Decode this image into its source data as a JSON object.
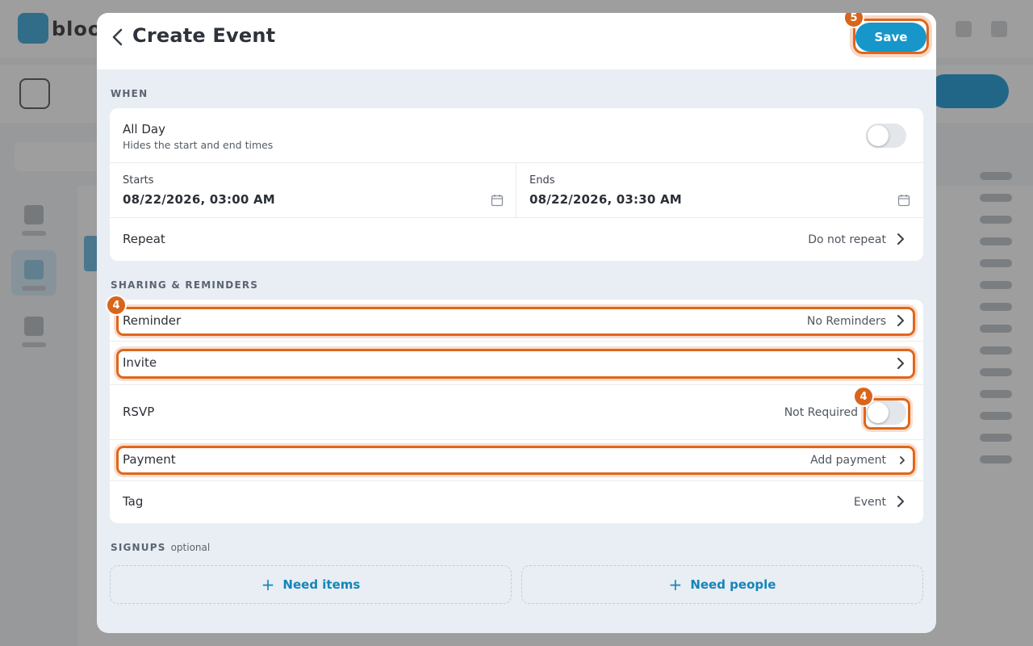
{
  "background": {
    "logo_text": "bloo"
  },
  "modal": {
    "title": "Create Event",
    "save_label": "Save",
    "save_badge": "5"
  },
  "when": {
    "section_label": "WHEN",
    "all_day": {
      "label": "All Day",
      "sub": "Hides the start and end times",
      "on": false
    },
    "starts": {
      "label": "Starts",
      "value": "08/22/2026, 03:00 AM"
    },
    "ends": {
      "label": "Ends",
      "value": "08/22/2026, 03:30 AM"
    },
    "repeat": {
      "label": "Repeat",
      "value": "Do not repeat"
    }
  },
  "sharing": {
    "section_label": "SHARING & REMINDERS",
    "reminder": {
      "label": "Reminder",
      "value": "No Reminders",
      "badge": "4"
    },
    "invite": {
      "label": "Invite"
    },
    "rsvp": {
      "label": "RSVP",
      "value": "Not Required",
      "on": false,
      "badge": "4"
    },
    "payment": {
      "label": "Payment",
      "value": "Add payment"
    },
    "tag": {
      "label": "Tag",
      "value": "Event"
    }
  },
  "signups": {
    "section_label": "SIGNUPS",
    "optional": "optional",
    "need_items": "Need items",
    "need_people": "Need people"
  },
  "colors": {
    "accent": "#1696c9",
    "highlight": "#e0661b"
  }
}
